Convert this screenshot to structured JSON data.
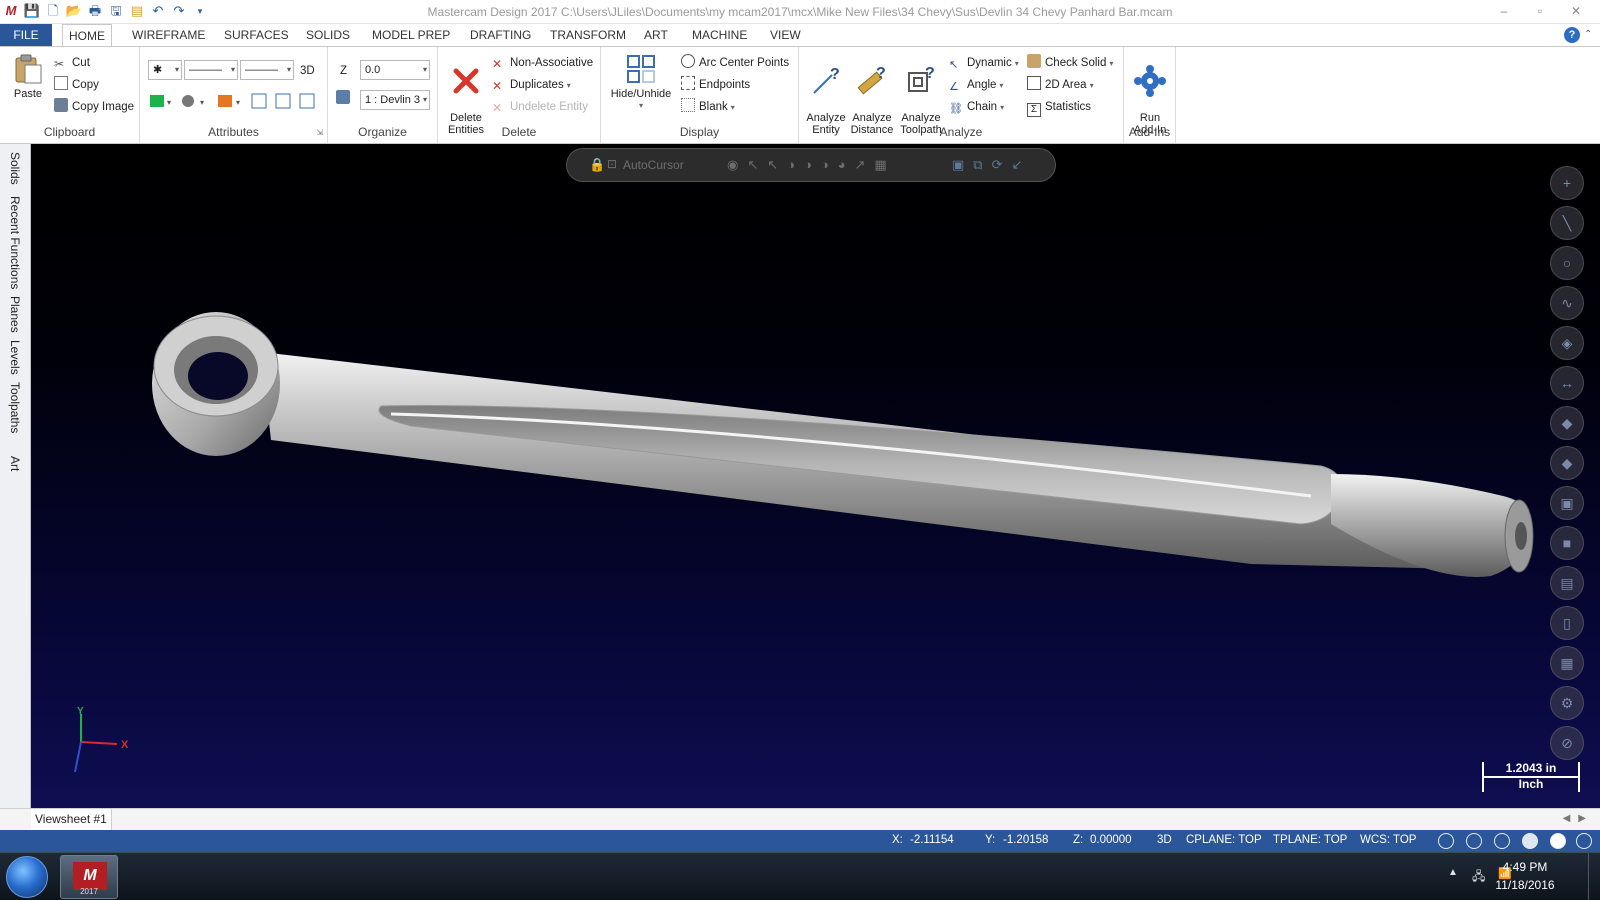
{
  "window": {
    "title": "Mastercam Design 2017  C:\\Users\\JLiles\\Documents\\my mcam2017\\mcx\\Mike New Files\\34 Chevy\\Sus\\Devlin 34 Chevy Panhard Bar.mcam",
    "controls": [
      "–",
      "▫",
      "✕"
    ]
  },
  "ribbon_tabs": [
    "FILE",
    "HOME",
    "WIREFRAME",
    "SURFACES",
    "SOLIDS",
    "MODEL PREP",
    "DRAFTING",
    "TRANSFORM",
    "ART",
    "MACHINE",
    "VIEW"
  ],
  "clipboard": {
    "label": "Clipboard",
    "paste": "Paste",
    "cut": "Cut",
    "copy": "Copy",
    "copy_image": "Copy Image"
  },
  "attributes": {
    "label": "Attributes",
    "point_style": "✱",
    "line_style": "———",
    "line_width": "———",
    "mode": "3D"
  },
  "organize": {
    "label": "Organize",
    "z_label": "Z",
    "z_value": "0.0",
    "level_value": "1 : Devlin 3"
  },
  "delete": {
    "label": "Delete",
    "delete_entities": "Delete\nEntities",
    "non_associative": "Non-Associative",
    "duplicates": "Duplicates",
    "undelete_entity": "Undelete Entity"
  },
  "display": {
    "label": "Display",
    "hide_unhide": "Hide/Unhide",
    "arc_center_points": "Arc Center Points",
    "endpoints": "Endpoints",
    "blank": "Blank"
  },
  "analyze": {
    "label": "Analyze",
    "analyze_entity": "Analyze\nEntity",
    "analyze_distance": "Analyze\nDistance",
    "analyze_toolpath": "Analyze\nToolpath",
    "dynamic": "Dynamic",
    "angle": "Angle",
    "chain": "Chain",
    "check_solid": "Check Solid",
    "area_2d": "2D Area",
    "statistics": "Statistics"
  },
  "addins": {
    "label": "Add-Ins",
    "run_addin": "Run\nAdd-In"
  },
  "side_tabs": [
    "Solids",
    "Recent Functions",
    "Planes",
    "Levels",
    "Toolpaths",
    "Art"
  ],
  "viewport": {
    "autocursor_label": "AutoCursor",
    "scale_value": "1.2043 in",
    "scale_unit": "Inch",
    "axis_x": "X",
    "axis_y": "Y"
  },
  "viewsheet": {
    "tab": "Viewsheet #1"
  },
  "status": {
    "x_label": "X:",
    "x_value": "-2.11154",
    "y_label": "Y:",
    "y_value": "-1.20158",
    "z_label": "Z:",
    "z_value": "0.00000",
    "mode": "3D",
    "cplane": "CPLANE: TOP",
    "tplane": "TPLANE: TOP",
    "wcs": "WCS: TOP"
  },
  "taskbar": {
    "app_label": "2017",
    "time": "4:49 PM",
    "date": "11/18/2016"
  },
  "colors": {
    "ribbon_blue": "#2b579a",
    "delete_red": "#d9352b",
    "viewport_bottom": "#0e0e52"
  }
}
